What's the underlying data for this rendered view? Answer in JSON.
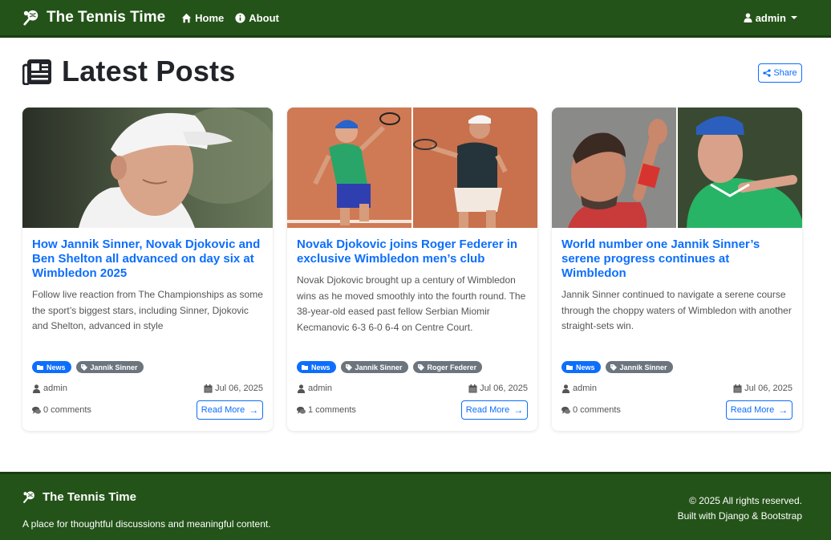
{
  "navbar": {
    "brand": "The Tennis Time",
    "links": [
      {
        "label": "Home",
        "icon": "home-icon"
      },
      {
        "label": "About",
        "icon": "info-icon"
      }
    ],
    "user": "admin"
  },
  "header": {
    "title": "Latest Posts",
    "share_label": "Share"
  },
  "posts": [
    {
      "title": "How Jannik Sinner, Novak Djokovic and Ben Shelton all advanced on day six at Wimbledon 2025",
      "excerpt": "Follow live reaction from The Championships as some the sport’s biggest stars, including Sinner, Djokovic and Shelton, advanced in style",
      "tags": [
        "News",
        "Jannik Sinner"
      ],
      "author": "admin",
      "date": "Jul 06, 2025",
      "comments": "0 comments",
      "read_more": "Read More"
    },
    {
      "title": "Novak Djokovic joins Roger Federer in exclusive Wimbledon men’s club",
      "excerpt": "Novak Djokovic brought up a century of Wimbledon wins as he moved smoothly into the fourth round. The 38-year-old eased past fellow Serbian Miomir Kecmanovic 6-3 6-0 6-4 on Centre Court.",
      "tags": [
        "News",
        "Jannik Sinner",
        "Roger Federer"
      ],
      "author": "admin",
      "date": "Jul 06, 2025",
      "comments": "1 comments",
      "read_more": "Read More"
    },
    {
      "title": "World number one Jannik Sinner’s serene progress continues at Wimbledon",
      "excerpt": "Jannik Sinner continued to navigate a serene course through the choppy waters of Wimbledon with another straight-sets win.",
      "tags": [
        "News",
        "Jannik Sinner"
      ],
      "author": "admin",
      "date": "Jul 06, 2025",
      "comments": "0 comments",
      "read_more": "Read More"
    }
  ],
  "footer": {
    "brand": "The Tennis Time",
    "tagline": "A place for thoughtful discussions and meaningful content.",
    "copyright": "© 2025 All rights reserved.",
    "built_with": "Built with Django & Bootstrap"
  },
  "colors": {
    "nav_bg": "#235318",
    "accent": "#0d6efd",
    "tag_gray": "#6c757d"
  }
}
